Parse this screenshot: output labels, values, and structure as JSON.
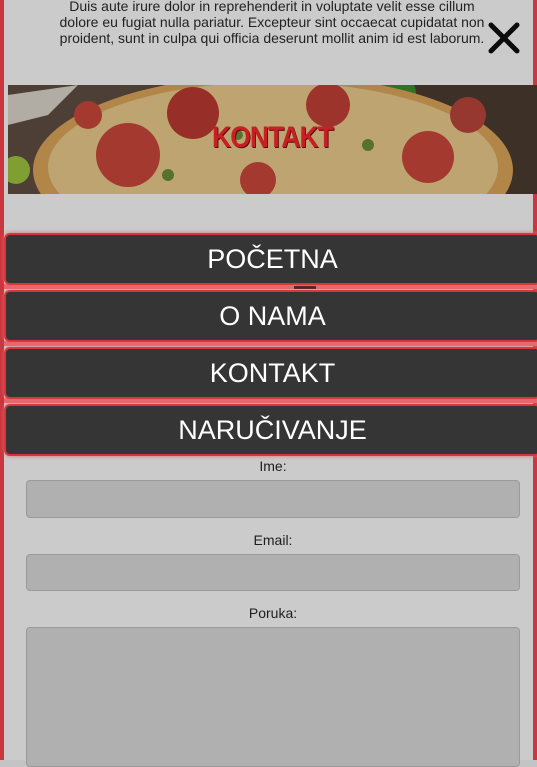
{
  "intro_text": {
    "line1": "Duis aute irure dolor in reprehenderit in voluptate velit esse cillum",
    "line2": "dolore eu fugiat nulla pariatur. Excepteur sint occaecat cupidatat non",
    "line3": "proident, sunt in culpa qui officia deserunt mollit anim id est laborum."
  },
  "banner": {
    "title": "KONTAKT"
  },
  "menu": {
    "items": [
      {
        "label": "POČETNA"
      },
      {
        "label": "O NAMA"
      },
      {
        "label": "KONTAKT"
      },
      {
        "label": "NARUČIVANJE"
      }
    ]
  },
  "form": {
    "name_label": "Ime:",
    "email_label": "Email:",
    "message_label": "Poruka:"
  },
  "icons": {
    "close": "close-icon"
  },
  "colors": {
    "accent": "#c9363d",
    "menu_bg": "#353535",
    "menu_text": "#ffffff"
  }
}
